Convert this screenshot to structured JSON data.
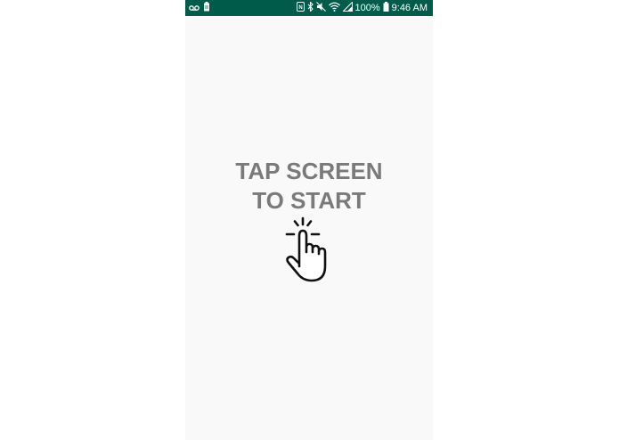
{
  "status_bar": {
    "battery_percent": "100%",
    "time": "9:46 AM",
    "left_icons": [
      "voicemail-icon",
      "battery-saver-icon"
    ],
    "right_icons": [
      "nfc-icon",
      "bluetooth-icon",
      "mute-icon",
      "wifi-icon",
      "signal-icon",
      "battery-icon"
    ],
    "background_color": "#005b4b"
  },
  "main": {
    "prompt_line1": "TAP SCREEN",
    "prompt_line2": "TO START",
    "prompt_color": "#7a7a7a",
    "icon": "tap-hand-icon"
  }
}
